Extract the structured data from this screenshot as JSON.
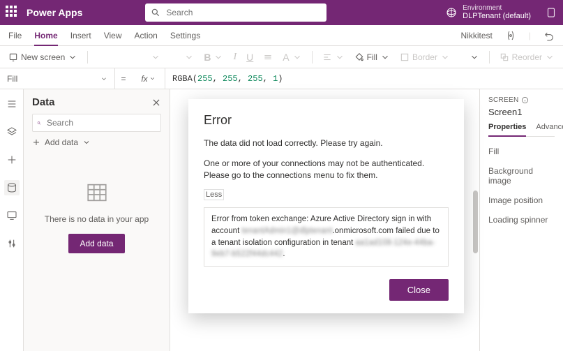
{
  "titlebar": {
    "app_name": "Power Apps",
    "search_placeholder": "Search",
    "env_label": "Environment",
    "env_name": "DLPTenant (default)"
  },
  "menubar": {
    "items": [
      "File",
      "Home",
      "Insert",
      "View",
      "Action",
      "Settings"
    ],
    "active": "Home",
    "username": "Nikkitest"
  },
  "ribbon": {
    "new_screen": "New screen",
    "fill": "Fill",
    "border": "Border",
    "reorder": "Reorder"
  },
  "formula": {
    "property": "Fill",
    "fx": "fx",
    "fn": "RGBA",
    "args": [
      "255",
      "255",
      "255",
      "1"
    ]
  },
  "data_panel": {
    "title": "Data",
    "search_placeholder": "Search",
    "add_data": "Add data",
    "empty_msg": "There is no data in your app",
    "add_btn": "Add data"
  },
  "prop_panel": {
    "screen_lbl": "SCREEN",
    "screen_name": "Screen1",
    "tabs": [
      "Properties",
      "Advanced"
    ],
    "props": [
      "Fill",
      "Background image",
      "Image position",
      "Loading spinner"
    ]
  },
  "modal": {
    "title": "Error",
    "p1": "The data did not load correctly. Please try again.",
    "p2": "One or more of your connections may not be authenticated. Please go to the connections menu to fix them.",
    "less": "Less",
    "detail_pre": "Error from token exchange: Azure Active Directory sign in with account ",
    "detail_blur1": "tenantAdmin1@dlptenant",
    "detail_mid": ".onmicrosoft.com failed due to a tenant isolation configuration in tenant ",
    "detail_blur2": "aa1ad108-124e-44ba-9eb7-b522f44dc442",
    "detail_post": ".",
    "close": "Close"
  }
}
